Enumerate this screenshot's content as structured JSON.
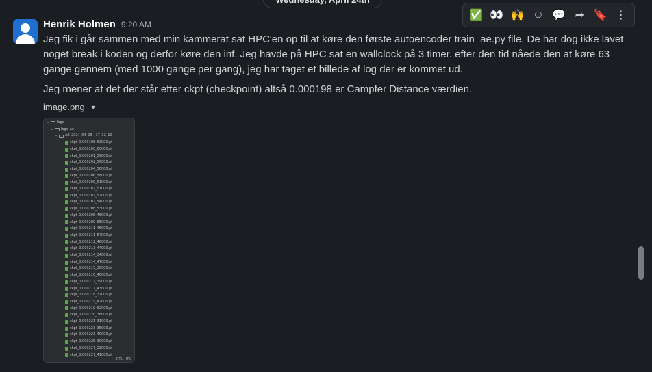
{
  "date_divider": "Wednesday, April 24th",
  "toolbar": [
    {
      "name": "check-reaction-icon",
      "glyph": "✅"
    },
    {
      "name": "eyes-reaction-icon",
      "glyph": "👀"
    },
    {
      "name": "raised-hands-reaction-icon",
      "glyph": "🙌"
    },
    {
      "name": "add-reaction-icon",
      "glyph": "☺"
    },
    {
      "name": "reply-thread-icon",
      "glyph": "💬"
    },
    {
      "name": "forward-icon",
      "glyph": "➦"
    },
    {
      "name": "bookmark-icon",
      "glyph": "🔖"
    },
    {
      "name": "more-actions-icon",
      "glyph": "⋮"
    }
  ],
  "message": {
    "author": "Henrik Holmen",
    "time": "9:20 AM",
    "paragraph1": "Jeg fik i går sammen med min kammerat sat HPC'en op til at køre den første autoencoder train_ae.py file. De har dog ikke lavet noget break i koden og derfor køre den inf. Jeg havde på HPC sat en wallclock på 3 timer. efter den tid nåede den at køre 63 gange gennem (med 1000 gange per gang), jeg har taget et billede af log der er kommet ud.",
    "paragraph2": "Jeg mener at det der står efter ckpt (checkpoint) altså 0.000198 er Campfer Distance værdien."
  },
  "attachment": {
    "filename": "image.png",
    "tree_root": "logs",
    "tree_sub": "logs_ae",
    "tree_run": "AE_2024_04_23__17_32_10",
    "files": [
      "ckpt_0.000198_63000.pt",
      "ckpt_0.000200_60000.pt",
      "ckpt_0.000201_59000.pt",
      "ckpt_0.000202_56000.pt",
      "ckpt_0.000204_56000.pt",
      "ckpt_0.000206_58000.pt",
      "ckpt_0.000206_61000.pt",
      "ckpt_0.000207_51000.pt",
      "ckpt_0.000207_52000.pt",
      "ckpt_0.000207_54000.pt",
      "ckpt_0.000208_53000.pt",
      "ckpt_0.000208_45000.pt",
      "ckpt_0.000209_55000.pt",
      "ckpt_0.000211_46000.pt",
      "ckpt_0.000211_57000.pt",
      "ckpt_0.000212_48000.pt",
      "ckpt_0.000213_44000.pt",
      "ckpt_0.000214_34000.pt",
      "ckpt_0.000214_47000.pt",
      "ckpt_0.000215_38000.pt",
      "ckpt_0.000216_40000.pt",
      "ckpt_0.000217_39000.pt",
      "ckpt_0.000217_43000.pt",
      "ckpt_0.000218_37000.pt",
      "ckpt_0.000219_42000.pt",
      "ckpt_0.000219_62000.pt",
      "ckpt_0.000220_36000.pt",
      "ckpt_0.000221_31000.pt",
      "ckpt_0.000223_35000.pt",
      "ckpt_0.000223_40000.pt",
      "ckpt_0.000225_30000.pt",
      "ckpt_0.000227_32000.pt",
      "ckpt_0.000227_41000.pt"
    ],
    "footer": "DTU HPC"
  }
}
